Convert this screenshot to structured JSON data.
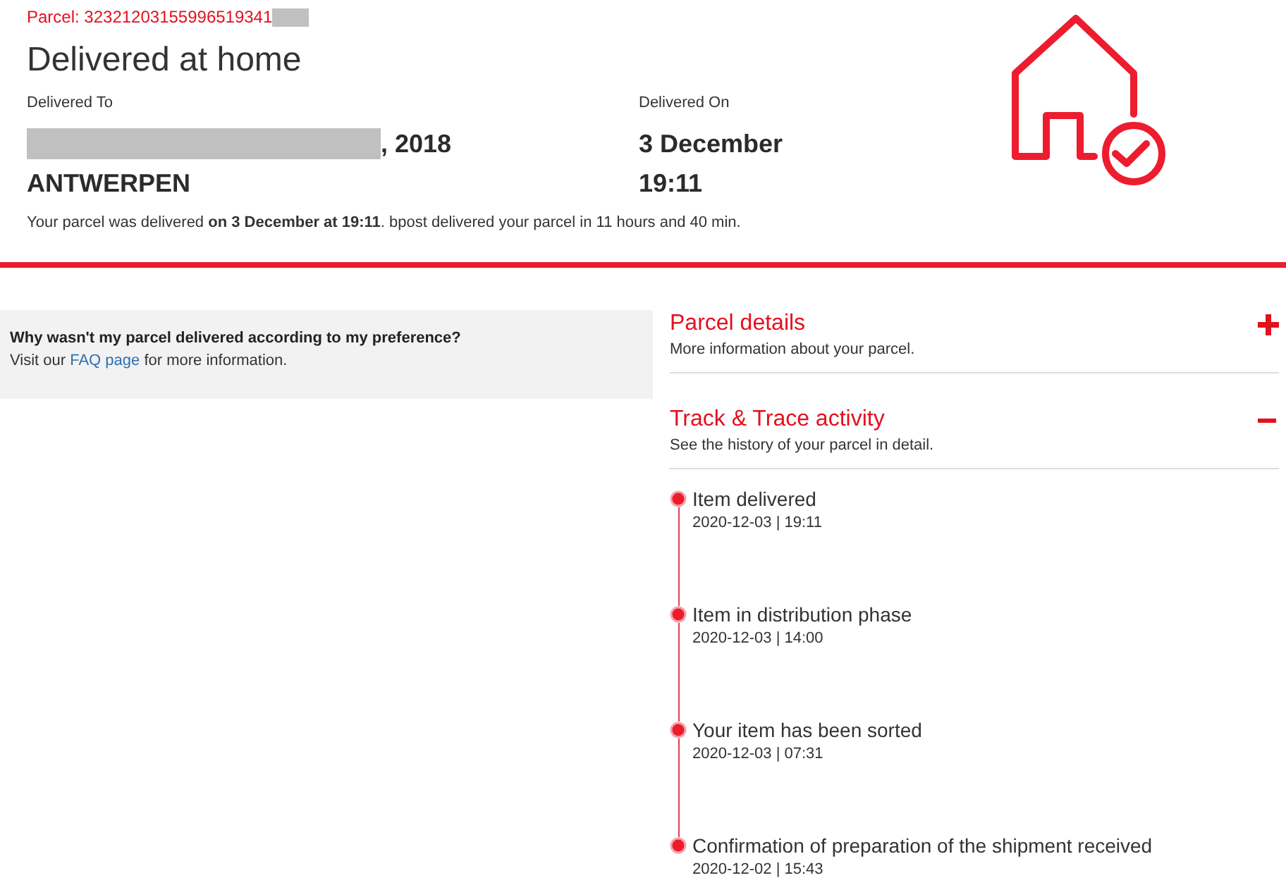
{
  "parcel": {
    "number": "Parcel: 32321203155996519341"
  },
  "title": "Delivered at home",
  "delivered_to": {
    "label": "Delivered To",
    "address_line": ", 2018",
    "city": "ANTWERPEN"
  },
  "delivered_on": {
    "label": "Delivered On",
    "date": "3 December",
    "time": "19:11"
  },
  "summary": "Your parcel was delivered **on 3 December at 19:11**. bpost delivered your parcel in 11 hours and 40 min.",
  "notice": {
    "question": "Why wasn't my parcel delivered according to my preference?",
    "text_before": "Visit our",
    "link": "FAQ page",
    "text_after": "for more information."
  },
  "sections": [
    {
      "title": "Parcel details",
      "subtitle": "More information about your parcel.",
      "expanded": false
    },
    {
      "title": "Track & Trace activity",
      "subtitle": "See the history of your parcel in detail.",
      "expanded": true,
      "events": [
        {
          "status": "Item delivered",
          "time": "2020-12-03 | 19:11"
        },
        {
          "status": "Item in distribution phase",
          "time": "2020-12-03 | 14:00"
        },
        {
          "status": "Your item has been sorted",
          "time": "2020-12-03 | 07:31"
        },
        {
          "status": "Confirmation of preparation of the shipment received",
          "time": "2020-12-02 | 15:43"
        }
      ]
    }
  ]
}
